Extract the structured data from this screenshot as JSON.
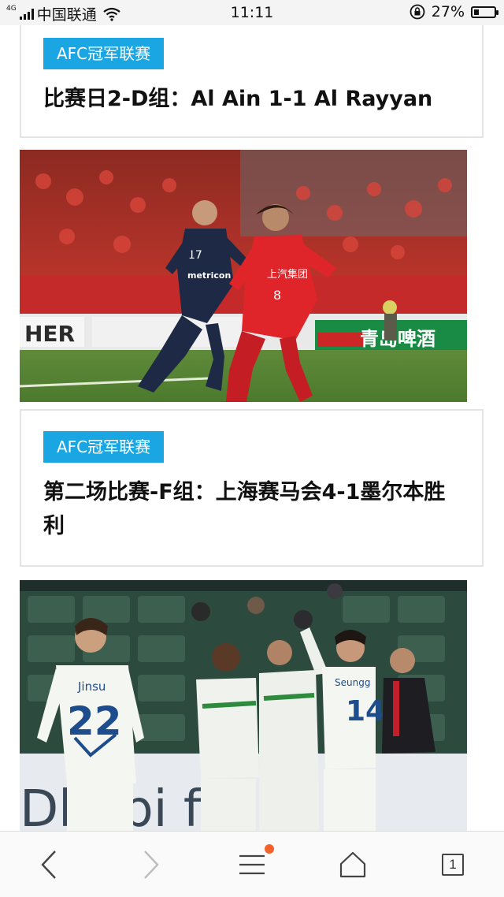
{
  "status_bar": {
    "network": "4G",
    "carrier": "中国联通",
    "time": "11:11",
    "battery": "27%",
    "battery_level": 0.27
  },
  "feed": {
    "cards": [
      {
        "tag": "AFC冠军联赛",
        "title": "比赛日2-D组：Al Ain 1-1 Al Rayyan"
      },
      {
        "tag": "AFC冠军联赛",
        "title": "第二场比赛-F组：上海赛马会4-1墨尔本胜利"
      }
    ],
    "photos": [
      {
        "name": "match-photo-shanghai-melbourne",
        "player_left_number": "17",
        "player_left_sponsor": "metricon",
        "player_right_number": "8",
        "player_right_sponsor": "上汽集团",
        "board_left": "HER",
        "board_right": "青岛啤酒"
      },
      {
        "name": "match-photo-jeonbuk-celebration",
        "player_left_name": "Jinsu",
        "player_left_number": "22",
        "player_right_name": "Seungg",
        "player_right_number": "14",
        "board_text": "Dhabi fcc"
      }
    ]
  },
  "nav": {
    "tab_count": "1",
    "menu_has_notification": true
  },
  "colors": {
    "tag_bg": "#1aa5e3",
    "notification_dot": "#f4622b"
  }
}
